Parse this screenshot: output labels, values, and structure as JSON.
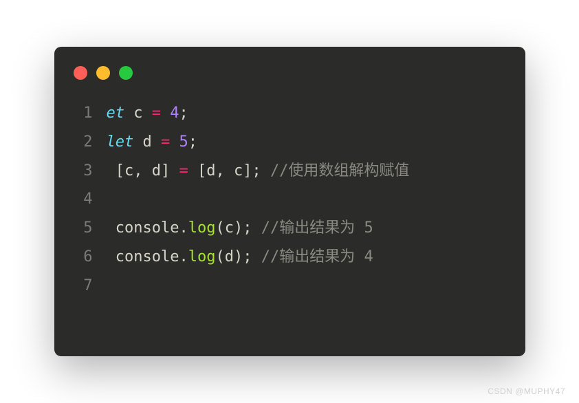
{
  "traffic_lights": {
    "red": "#ff5f56",
    "yellow": "#ffbd2e",
    "green": "#27c93f"
  },
  "code_lines": [
    {
      "num": "1",
      "tokens": [
        {
          "cls": "kw-it",
          "text": "et"
        },
        {
          "cls": "ident",
          "text": " c "
        },
        {
          "cls": "op",
          "text": "="
        },
        {
          "cls": "ident",
          "text": " "
        },
        {
          "cls": "num",
          "text": "4"
        },
        {
          "cls": "punct",
          "text": ";"
        }
      ]
    },
    {
      "num": "2",
      "tokens": [
        {
          "cls": "kw-it",
          "text": "let"
        },
        {
          "cls": "ident",
          "text": " d "
        },
        {
          "cls": "op",
          "text": "="
        },
        {
          "cls": "ident",
          "text": " "
        },
        {
          "cls": "num",
          "text": "5"
        },
        {
          "cls": "punct",
          "text": ";"
        }
      ]
    },
    {
      "num": "3",
      "tokens": [
        {
          "cls": "punct",
          "text": " [c, d] "
        },
        {
          "cls": "op",
          "text": "="
        },
        {
          "cls": "punct",
          "text": " [d, c]; "
        },
        {
          "cls": "comment",
          "text": "//使用数组解构赋值"
        }
      ]
    },
    {
      "num": "4",
      "tokens": []
    },
    {
      "num": "5",
      "tokens": [
        {
          "cls": "ident",
          "text": " console."
        },
        {
          "cls": "fn",
          "text": "log"
        },
        {
          "cls": "punct",
          "text": "(c); "
        },
        {
          "cls": "comment",
          "text": "//输出结果为 5"
        }
      ]
    },
    {
      "num": "6",
      "tokens": [
        {
          "cls": "ident",
          "text": " console."
        },
        {
          "cls": "fn",
          "text": "log"
        },
        {
          "cls": "punct",
          "text": "(d); "
        },
        {
          "cls": "comment",
          "text": "//输出结果为 4"
        }
      ]
    },
    {
      "num": "7",
      "tokens": []
    }
  ],
  "watermark": "CSDN @MUPHY47"
}
